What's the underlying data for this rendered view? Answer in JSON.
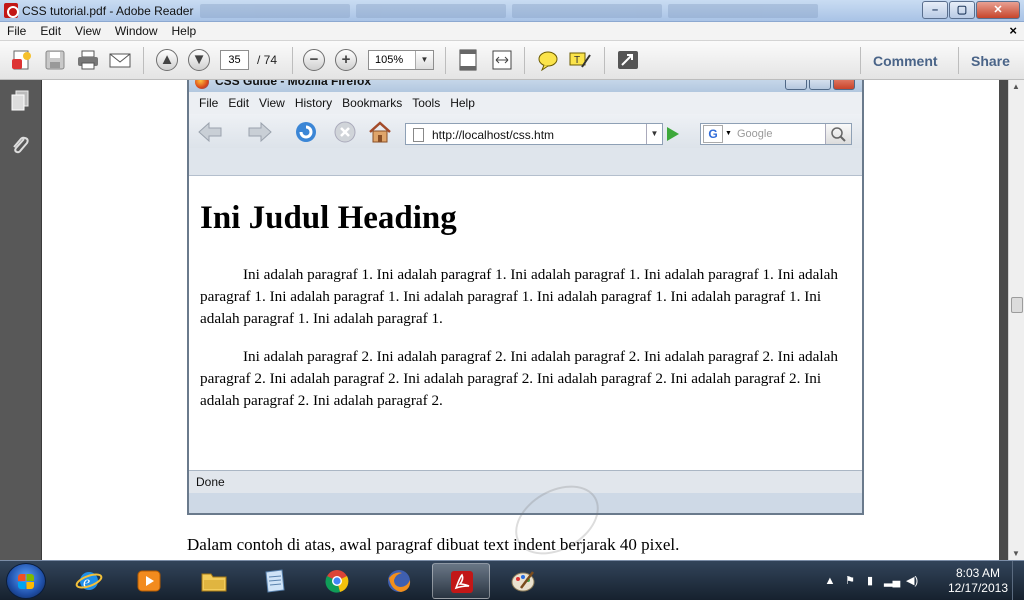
{
  "window": {
    "title": "CSS tutorial.pdf - Adobe Reader"
  },
  "menu": [
    "File",
    "Edit",
    "View",
    "Window",
    "Help"
  ],
  "menu_close": "×",
  "toolbar": {
    "page_current": "35",
    "page_total": "/ 74",
    "zoom": "105%",
    "comment_label": "Comment",
    "share_label": "Share"
  },
  "firefox": {
    "title": "CSS Guide - Mozilla Firefox",
    "menu": [
      "File",
      "Edit",
      "View",
      "History",
      "Bookmarks",
      "Tools",
      "Help"
    ],
    "url": "http://localhost/css.htm",
    "search_placeholder": "Google",
    "heading": "Ini Judul Heading",
    "paragraph1": "Ini adalah paragraf 1. Ini adalah paragraf 1. Ini adalah paragraf 1. Ini adalah paragraf 1. Ini adalah paragraf 1. Ini adalah paragraf 1. Ini adalah paragraf 1. Ini adalah paragraf 1. Ini adalah paragraf 1. Ini adalah paragraf 1. Ini adalah paragraf 1.",
    "paragraph2": "Ini adalah paragraf 2. Ini adalah paragraf 2. Ini adalah paragraf 2. Ini adalah paragraf 2. Ini adalah paragraf 2. Ini adalah paragraf 2. Ini adalah paragraf 2. Ini adalah paragraf 2. Ini adalah paragraf 2. Ini adalah paragraf 2. Ini adalah paragraf 2.",
    "status": "Done"
  },
  "document": {
    "body_text": "Dalam contoh di atas, awal paragraf dibuat text indent berjarak 40 pixel."
  },
  "taskbar": {
    "apps": [
      "internet-explorer-icon",
      "media-player-icon",
      "file-explorer-icon",
      "notepad-icon",
      "chrome-icon",
      "firefox-icon",
      "adobe-reader-icon",
      "paint-icon"
    ],
    "active_app": "adobe-reader-icon",
    "time": "8:03 AM",
    "date": "12/17/2013"
  },
  "colors": {
    "accent": "#4a6488",
    "reader_red": "#c21717",
    "taskbar": "#1d2a3a"
  }
}
